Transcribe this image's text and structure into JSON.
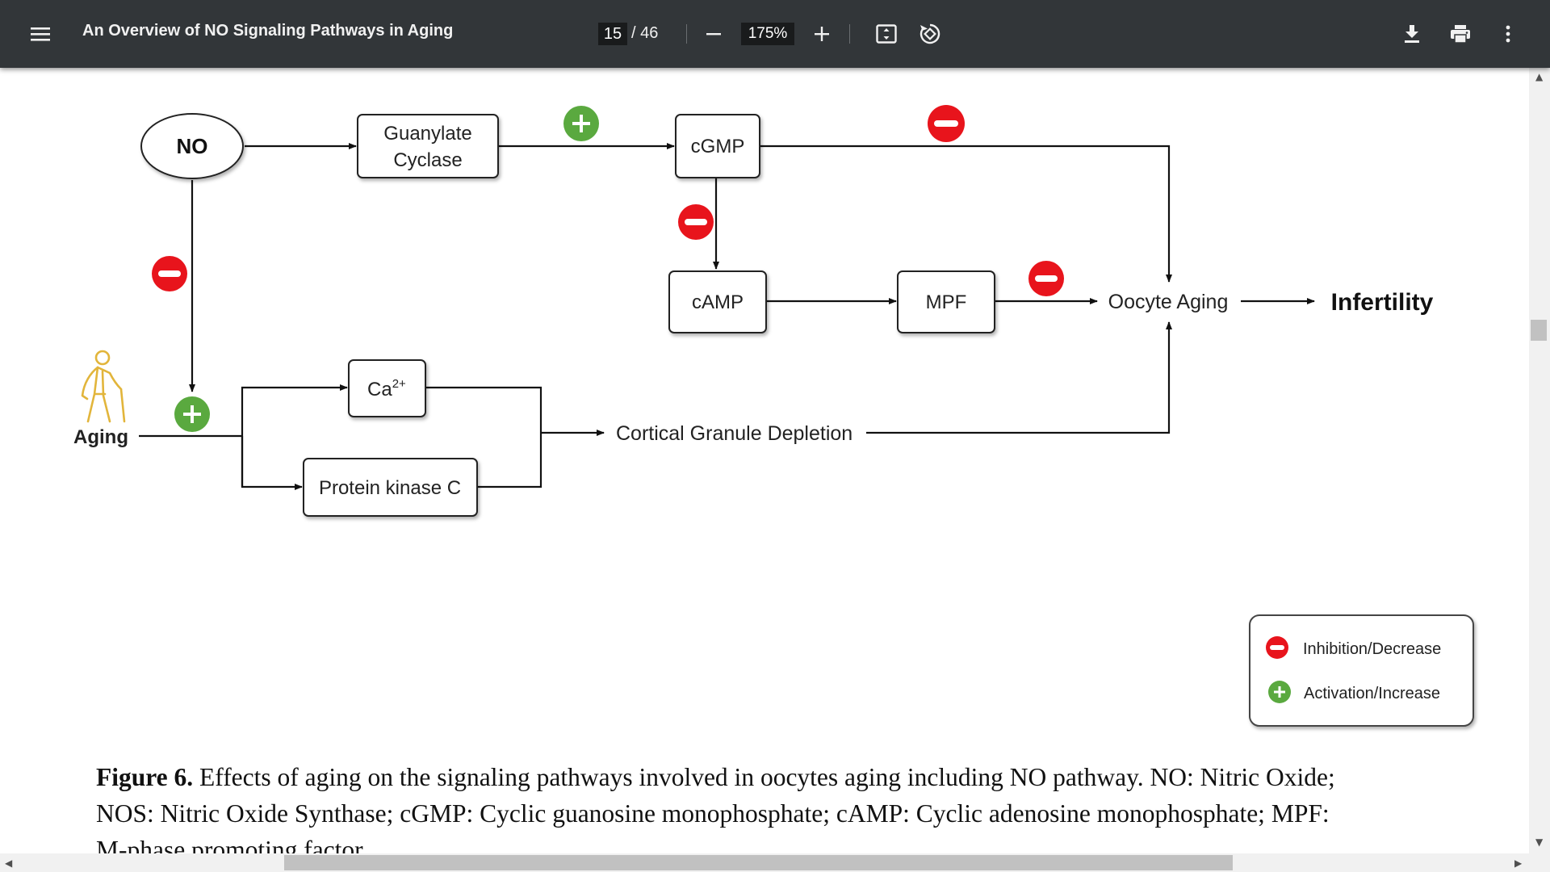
{
  "toolbar": {
    "menu_icon": "hamburger-menu-icon",
    "title": "An Overview of NO Signaling Pathways in Aging",
    "current_page": "15",
    "page_total": "/ 46",
    "zoom_out_icon": "minus-icon",
    "zoom_level": "175%",
    "zoom_in_icon": "plus-icon",
    "fit_icon": "fit-to-page-icon",
    "rotate_icon": "rotate-icon",
    "download_icon": "download-icon",
    "print_icon": "print-icon",
    "more_icon": "more-vertical-icon"
  },
  "diagram": {
    "nodes": {
      "no": "NO",
      "guanylate_line1": "Guanylate",
      "guanylate_line2": "Cyclase",
      "cgmp": "cGMP",
      "camp": "cAMP",
      "mpf": "MPF",
      "oocyte_aging": "Oocyte Aging",
      "infertility": "Infertility",
      "aging": "Aging",
      "ca": "Ca",
      "ca_sup": "2+",
      "protein_kinase": "Protein kinase C",
      "cortical": "Cortical Granule Depletion"
    },
    "legend": {
      "inhibition": "Inhibition/Decrease",
      "activation": "Activation/Increase"
    },
    "colors": {
      "inhibit": "#e8141c",
      "activate": "#5aa93f",
      "aging_icon": "#e2b53b"
    }
  },
  "caption": {
    "label": "Figure 6.",
    "line1": " Effects of aging on the signaling pathways involved in oocytes aging including NO pathway. NO: Nitric Oxide;",
    "line2": "NOS: Nitric Oxide Synthase; cGMP: Cyclic guanosine monophosphate; cAMP: Cyclic adenosine monophosphate; MPF:",
    "line3": "M-phase promoting factor."
  }
}
